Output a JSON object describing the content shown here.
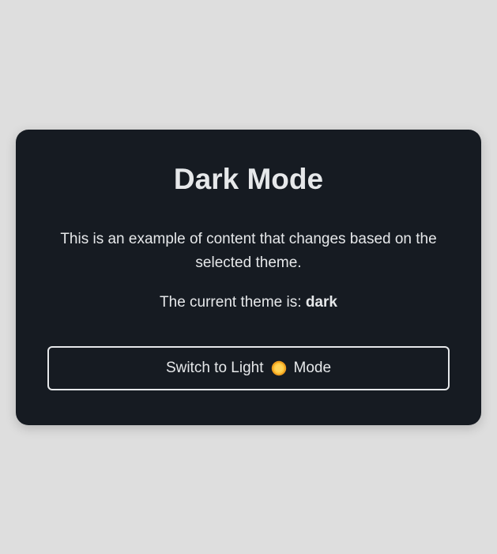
{
  "card": {
    "title": "Dark Mode",
    "description": "This is an example of content that changes based on the selected theme.",
    "current_prefix": "The current theme is:",
    "current_theme": "dark"
  },
  "toggle": {
    "label_before": "Switch to Light",
    "icon": "sun-icon",
    "label_after": "Mode"
  },
  "colors": {
    "background": "#dedede",
    "card_background": "#161b22",
    "text": "#e6e8ea",
    "sun": "#f5b82e"
  }
}
